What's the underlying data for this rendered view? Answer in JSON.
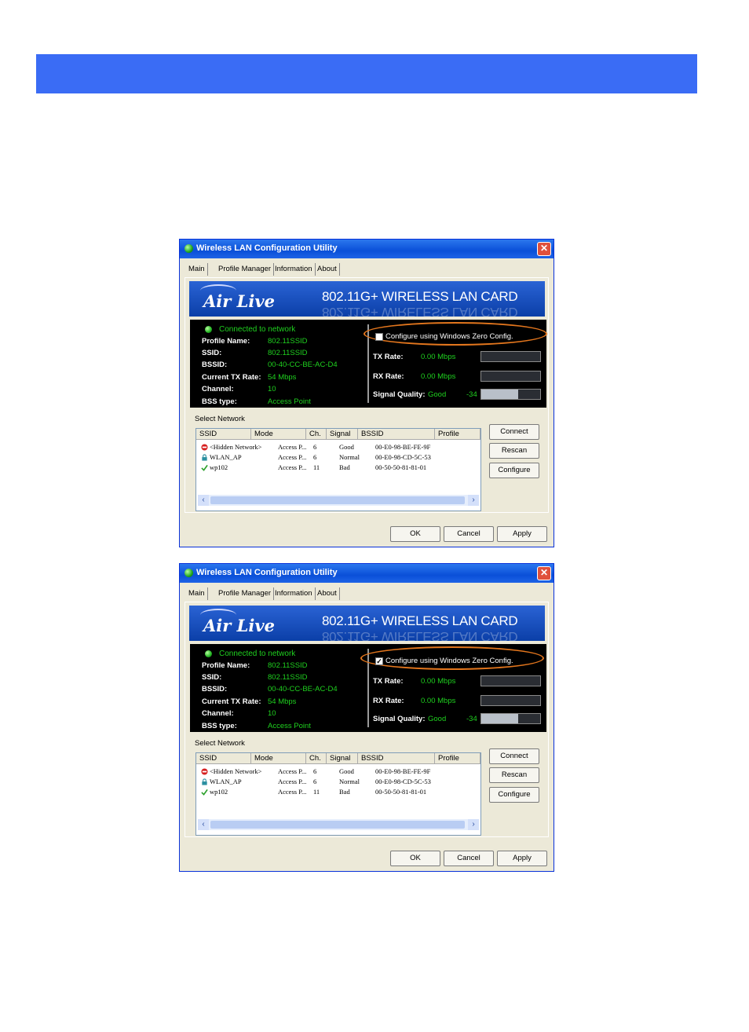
{
  "windows": [
    {
      "title": "Wireless LAN Configuration Utility",
      "tabs": [
        "Main",
        "Profile Manager",
        "Information",
        "About"
      ],
      "brand": "Air Live",
      "product": "802.11G+ WIRELESS LAN CARD",
      "connected_text": "Connected to network",
      "fields": [
        {
          "label": "Profile Name:",
          "value": "802.11SSID"
        },
        {
          "label": "SSID:",
          "value": "802.11SSID"
        },
        {
          "label": "BSSID:",
          "value": "00-40-CC-BE-AC-D4"
        },
        {
          "label": "Current TX Rate:",
          "value": "54 Mbps"
        },
        {
          "label": "Channel:",
          "value": "10"
        },
        {
          "label": "BSS type:",
          "value": "Access Point"
        }
      ],
      "zero_config_label": "Configure using Windows Zero Config.",
      "zero_config_checked": false,
      "tx_label": "TX Rate:",
      "tx_value": "0.00 Mbps",
      "rx_label": "RX Rate:",
      "rx_value": "0.00 Mbps",
      "signal_label": "Signal Quality:",
      "signal_quality": "Good",
      "signal_value": "-34",
      "signal_level": 0.62,
      "select_network_label": "Select Network",
      "columns": [
        "SSID",
        "Mode",
        "Ch.",
        "Signal",
        "BSSID",
        "Profile"
      ],
      "networks": [
        {
          "icon": "no-entry-icon",
          "ssid": "<Hidden Network>",
          "mode": "Access P...",
          "ch": "6",
          "signal": "Good",
          "bssid": "00-E0-98-BE-FE-9F"
        },
        {
          "icon": "lock-icon",
          "ssid": "WLAN_AP",
          "mode": "Access P...",
          "ch": "6",
          "signal": "Normal",
          "bssid": "00-E0-98-CD-5C-53"
        },
        {
          "icon": "check-icon",
          "ssid": "wp102",
          "mode": "Access P...",
          "ch": "11",
          "signal": "Bad",
          "bssid": "00-50-50-81-81-01"
        }
      ],
      "side_buttons": [
        "Connect",
        "Rescan",
        "Configure"
      ],
      "bottom_buttons": [
        "OK",
        "Cancel",
        "Apply"
      ]
    },
    {
      "title": "Wireless LAN Configuration Utility",
      "tabs": [
        "Main",
        "Profile Manager",
        "Information",
        "About"
      ],
      "brand": "Air Live",
      "product": "802.11G+ WIRELESS LAN CARD",
      "connected_text": "Connected to network",
      "fields": [
        {
          "label": "Profile Name:",
          "value": "802.11SSID"
        },
        {
          "label": "SSID:",
          "value": "802.11SSID"
        },
        {
          "label": "BSSID:",
          "value": "00-40-CC-BE-AC-D4"
        },
        {
          "label": "Current TX Rate:",
          "value": "54 Mbps"
        },
        {
          "label": "Channel:",
          "value": "10"
        },
        {
          "label": "BSS type:",
          "value": "Access Point"
        }
      ],
      "zero_config_label": "Configure using Windows Zero Config.",
      "zero_config_checked": true,
      "tx_label": "TX Rate:",
      "tx_value": "0.00 Mbps",
      "rx_label": "RX Rate:",
      "rx_value": "0.00 Mbps",
      "signal_label": "Signal Quality:",
      "signal_quality": "Good",
      "signal_value": "-34",
      "signal_level": 0.62,
      "select_network_label": "Select Network",
      "columns": [
        "SSID",
        "Mode",
        "Ch.",
        "Signal",
        "BSSID",
        "Profile"
      ],
      "networks": [
        {
          "icon": "no-entry-icon",
          "ssid": "<Hidden Network>",
          "mode": "Access P...",
          "ch": "6",
          "signal": "Good",
          "bssid": "00-E0-98-BE-FE-9F"
        },
        {
          "icon": "lock-icon",
          "ssid": "WLAN_AP",
          "mode": "Access P...",
          "ch": "6",
          "signal": "Normal",
          "bssid": "00-E0-98-CD-5C-53"
        },
        {
          "icon": "check-icon",
          "ssid": "wp102",
          "mode": "Access P...",
          "ch": "11",
          "signal": "Bad",
          "bssid": "00-50-50-81-81-01"
        }
      ],
      "side_buttons": [
        "Connect",
        "Rescan",
        "Configure"
      ],
      "bottom_buttons": [
        "OK",
        "Cancel",
        "Apply"
      ]
    }
  ]
}
